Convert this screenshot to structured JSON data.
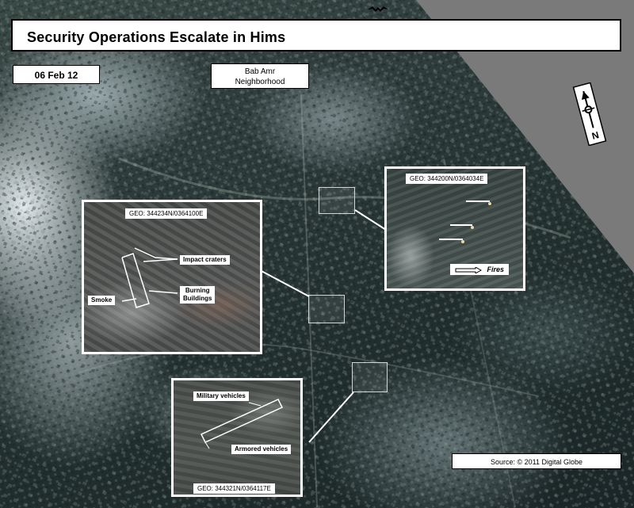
{
  "title": "Security Operations Escalate in Hims",
  "date": "06 Feb 12",
  "neighborhood": {
    "line1": "Bab Amr",
    "line2": "Neighborhood"
  },
  "source": "Source: © 2011 Digital Globe",
  "insets": {
    "left": {
      "geo": "GEO: 344234N/0364100E",
      "callouts": {
        "impact": "Impact craters",
        "burning_line1": "Burning",
        "burning_line2": "Buildings",
        "smoke": "Smoke"
      }
    },
    "right": {
      "geo": "GEO: 344200N/0364034E",
      "fires": "Fires"
    },
    "bottom": {
      "geo": "GEO: 344321N/0364117E",
      "callouts": {
        "military": "Military vehicles",
        "armored": "Armored vehicles"
      }
    }
  },
  "north_arrow": {
    "letter": "N"
  },
  "colors": {
    "label_bg": "#ffffff",
    "inset_border": "#ffffff",
    "outside_area": "#7a7a7a"
  }
}
